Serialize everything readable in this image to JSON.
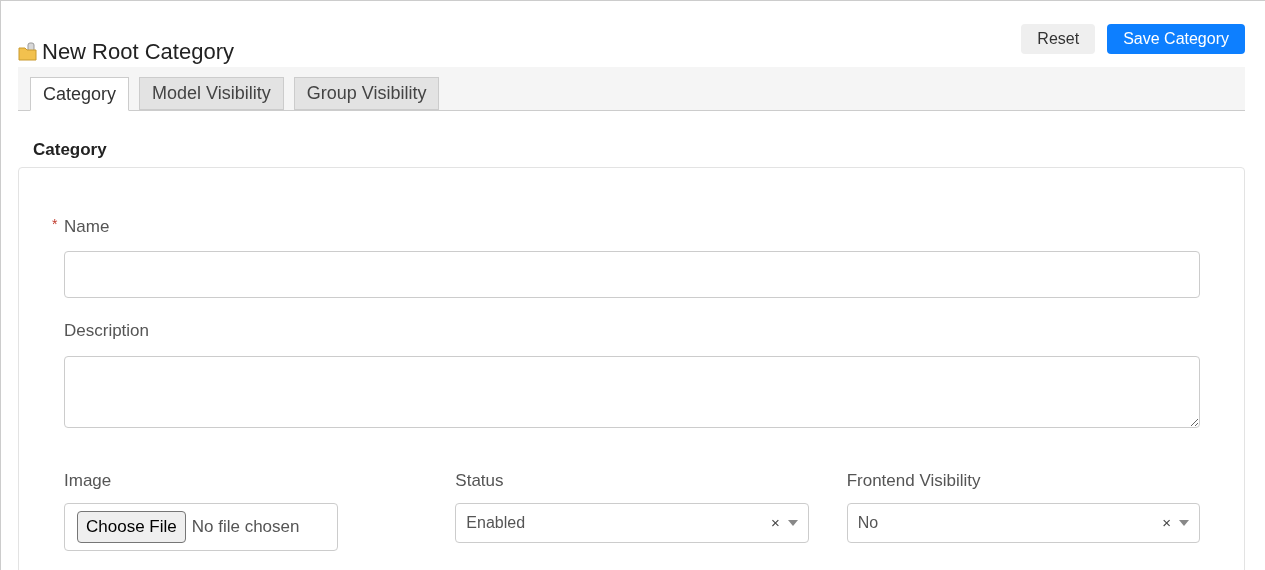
{
  "header": {
    "title": "New Root Category",
    "buttons": [
      {
        "label": "Reset",
        "kind": "secondary"
      },
      {
        "label": "Save Category",
        "kind": "primary"
      }
    ]
  },
  "tabs": [
    {
      "label": "Category",
      "selected": true
    },
    {
      "label": "Model Visibility",
      "selected": false
    },
    {
      "label": "Group Visibility",
      "selected": false
    }
  ],
  "section_title": "Category",
  "fields": [
    {
      "kind": "text",
      "label": "Name",
      "required_mark": "*"
    },
    {
      "kind": "textarea",
      "label": "Description"
    }
  ],
  "row": [
    {
      "kind": "file",
      "label": "Image",
      "button": "Choose File",
      "value": "No file chosen"
    },
    {
      "kind": "select",
      "label": "Status",
      "value": "Enabled",
      "clear": "×"
    },
    {
      "kind": "select",
      "label": "Frontend Visibility",
      "value": "No",
      "clear": "×"
    }
  ]
}
